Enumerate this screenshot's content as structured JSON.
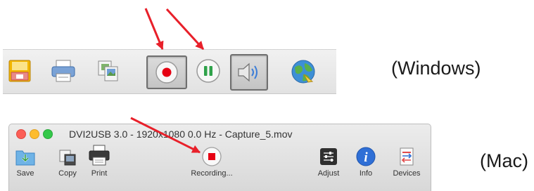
{
  "windows": {
    "label": "(Windows)",
    "toolbar": {
      "buttons": [
        {
          "icon": "save-icon"
        },
        {
          "icon": "print-icon"
        },
        {
          "icon": "copy-icon"
        },
        {
          "icon": "record-icon",
          "state": "pressed"
        },
        {
          "icon": "pause-icon"
        },
        {
          "icon": "speaker-icon",
          "state": "pressed"
        },
        {
          "icon": "globe-icon"
        }
      ]
    }
  },
  "mac": {
    "label": "(Mac)",
    "window": {
      "title": "DVI2USB 3.0 - 1920x1080 0.0 Hz - Capture_5.mov",
      "toolbar": {
        "save_label": "Save",
        "copy_label": "Copy",
        "print_label": "Print",
        "record_label": "Recording...",
        "adjust_label": "Adjust",
        "info_label": "Info",
        "devices_label": "Devices"
      }
    }
  },
  "colors": {
    "arrow": "#e8202a",
    "record": "#e60012",
    "pause": "#2fa24a",
    "info": "#2f6fd6"
  }
}
